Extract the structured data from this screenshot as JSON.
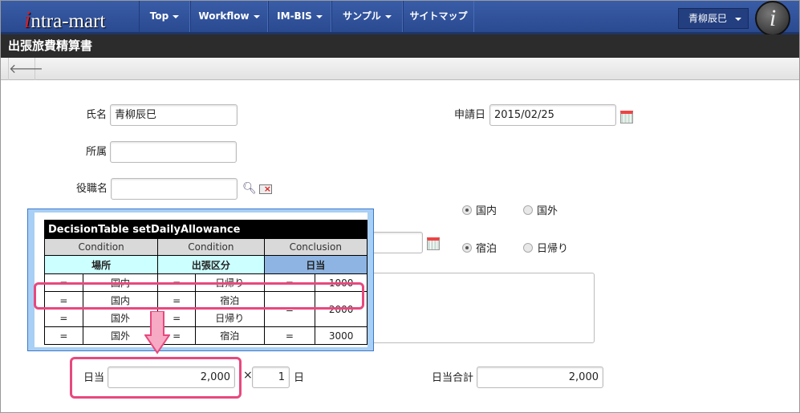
{
  "nav": {
    "logo": "intra-mart",
    "items": [
      {
        "label": "Top",
        "dropdown": true
      },
      {
        "label": "Workflow",
        "dropdown": true
      },
      {
        "label": "IM-BIS",
        "dropdown": true
      },
      {
        "label": "サンプル",
        "dropdown": true
      },
      {
        "label": "サイトマップ",
        "dropdown": false
      }
    ],
    "user": "青柳辰巳",
    "info_icon": "i"
  },
  "page": {
    "title": "出張旅費精算書",
    "back": "🡐"
  },
  "form": {
    "name_label": "氏名",
    "name_value": "青柳辰巳",
    "dept_label": "所属",
    "dept_value": "",
    "position_label": "役職名",
    "position_value": "",
    "date_label": "申請日",
    "date_value": "2015/02/25",
    "place_options": [
      "国内",
      "国外"
    ],
    "place_selected": "国内",
    "trip_options": [
      "宿泊",
      "日帰り"
    ],
    "trip_selected": "宿泊",
    "daily_label": "日当",
    "daily_value": "2,000",
    "times": "×",
    "days_value": "1",
    "days_unit": "日",
    "total_label": "日当合計",
    "total_value": "2,000"
  },
  "decision_table": {
    "title": "DecisionTable setDailyAllowance",
    "kinds": [
      "Condition",
      "Condition",
      "Conclusion"
    ],
    "headers": [
      "場所",
      "出張区分",
      "日当"
    ],
    "rows": [
      {
        "op1": "=",
        "place": "国内",
        "op2": "=",
        "trip": "日帰り",
        "op3": "=",
        "amount": "1000"
      },
      {
        "op1": "=",
        "place": "国内",
        "op2": "=",
        "trip": "宿泊",
        "op3": "=",
        "amount": "2000"
      },
      {
        "op1": "=",
        "place": "国外",
        "op2": "=",
        "trip": "日帰り"
      },
      {
        "op1": "=",
        "place": "国外",
        "op2": "=",
        "trip": "宿泊",
        "op3": "=",
        "amount": "3000"
      }
    ]
  },
  "colors": {
    "nav": "#2f4f98",
    "highlight": "#e8487e",
    "overlay": "#a8cff5"
  }
}
